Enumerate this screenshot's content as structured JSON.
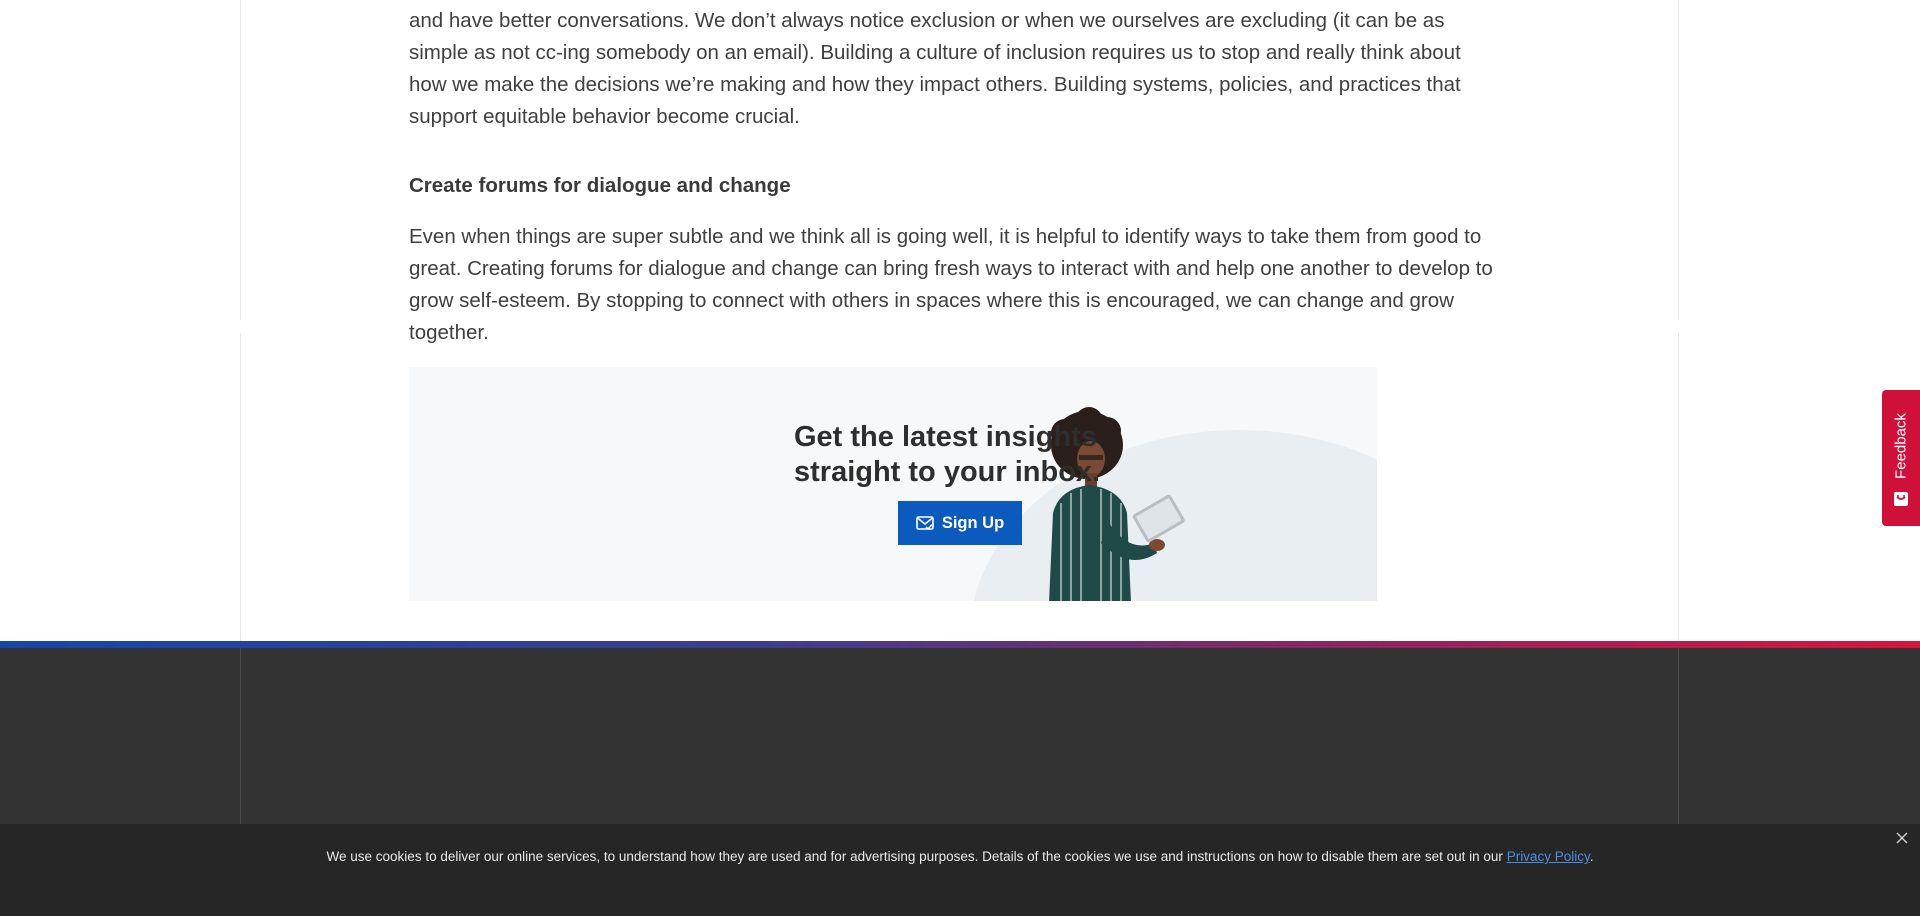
{
  "article": {
    "paragraph1": "and have better conversations. We don’t always notice exclusion or when we ourselves are excluding (it can be as simple as not cc-ing somebody on an email). Building a culture of inclusion requires us to stop and really think about how we make the decisions we’re making and how they impact others. Building systems, policies, and practices that support equitable behavior become crucial.",
    "heading": "Create forums for dialogue and change",
    "paragraph2": "Even when things are super subtle and we think all is going well, it is helpful to identify ways to take them from good to great. Creating forums for dialogue and change can bring fresh ways to interact with and help one another to develop to grow self-esteem. By stopping to connect with others in spaces where this is encouraged, we can change and grow together."
  },
  "promo": {
    "title_line1": "Get the latest insights",
    "title_line2": "straight to your inbox.",
    "button_label": "Sign Up",
    "button_icon": "envelope-check-icon",
    "button_color": "#0a5bbd"
  },
  "feedback": {
    "label": "Feedback",
    "icon": "feedback-chat-icon",
    "color": "#cf1139"
  },
  "cookie_banner": {
    "text": "We use cookies to deliver our online services, to understand how they are used and for advertising purposes. Details of the cookies we use and instructions on how to disable them are set out in our ",
    "link_text": "Privacy Policy",
    "suffix": ".",
    "close_icon": "close-icon"
  },
  "footer": {
    "stripe_colors": [
      "#1549a8",
      "#3f3c8f",
      "#8b2661",
      "#d7163c"
    ],
    "background": "#333333"
  }
}
